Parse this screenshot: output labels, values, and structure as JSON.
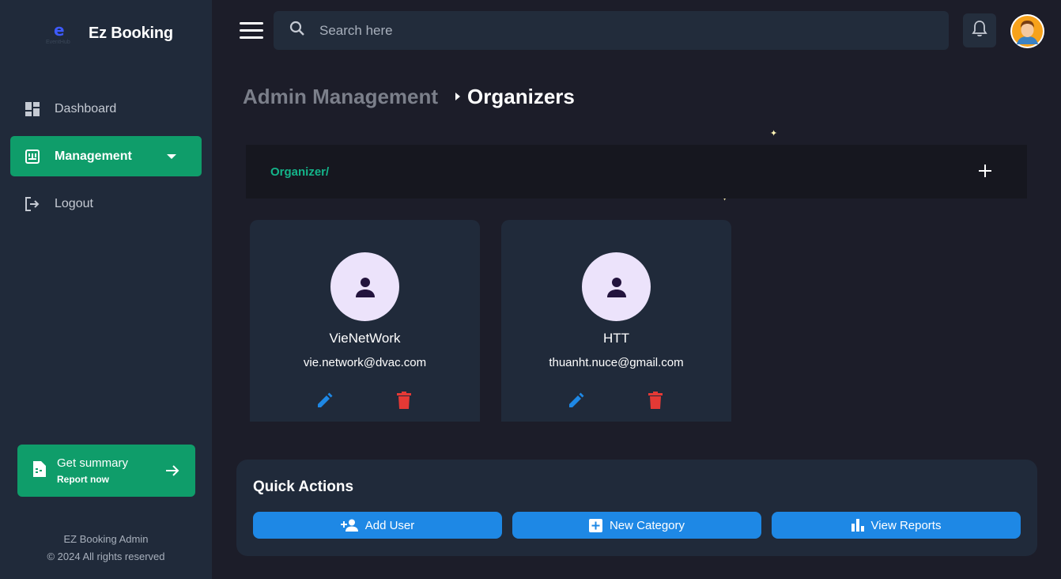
{
  "brand": {
    "logo_text": "EventHub",
    "name": "Ez Booking"
  },
  "sidebar": {
    "items": [
      {
        "label": "Dashboard",
        "icon": "dashboard-icon"
      },
      {
        "label": "Management",
        "icon": "management-icon",
        "active": true
      },
      {
        "label": "Logout",
        "icon": "logout-icon"
      }
    ],
    "summary": {
      "title": "Get summary",
      "subtitle": "Report now"
    },
    "footer": {
      "line1": "EZ Booking Admin",
      "line2": "© 2024 All rights reserved"
    }
  },
  "topbar": {
    "search_placeholder": "Search here"
  },
  "breadcrumb": {
    "parent": "Admin Management",
    "current": "Organizers"
  },
  "organizer_bar": {
    "path": "Organizer/"
  },
  "organizers": [
    {
      "name": "VieNetWork",
      "email": "vie.network@dvac.com"
    },
    {
      "name": "HTT",
      "email": "thuanht.nuce@gmail.com"
    }
  ],
  "quick_actions": {
    "title": "Quick Actions",
    "buttons": [
      {
        "label": "Add User",
        "icon": "add-user-icon"
      },
      {
        "label": "New Category",
        "icon": "add-box-icon"
      },
      {
        "label": "View Reports",
        "icon": "bar-chart-icon"
      }
    ]
  },
  "colors": {
    "accent": "#0f9d6a",
    "primary_button": "#1e88e5",
    "delete": "#e53935",
    "edit": "#1e88e5",
    "background": "#1c1d29",
    "panel": "#202a3a"
  }
}
